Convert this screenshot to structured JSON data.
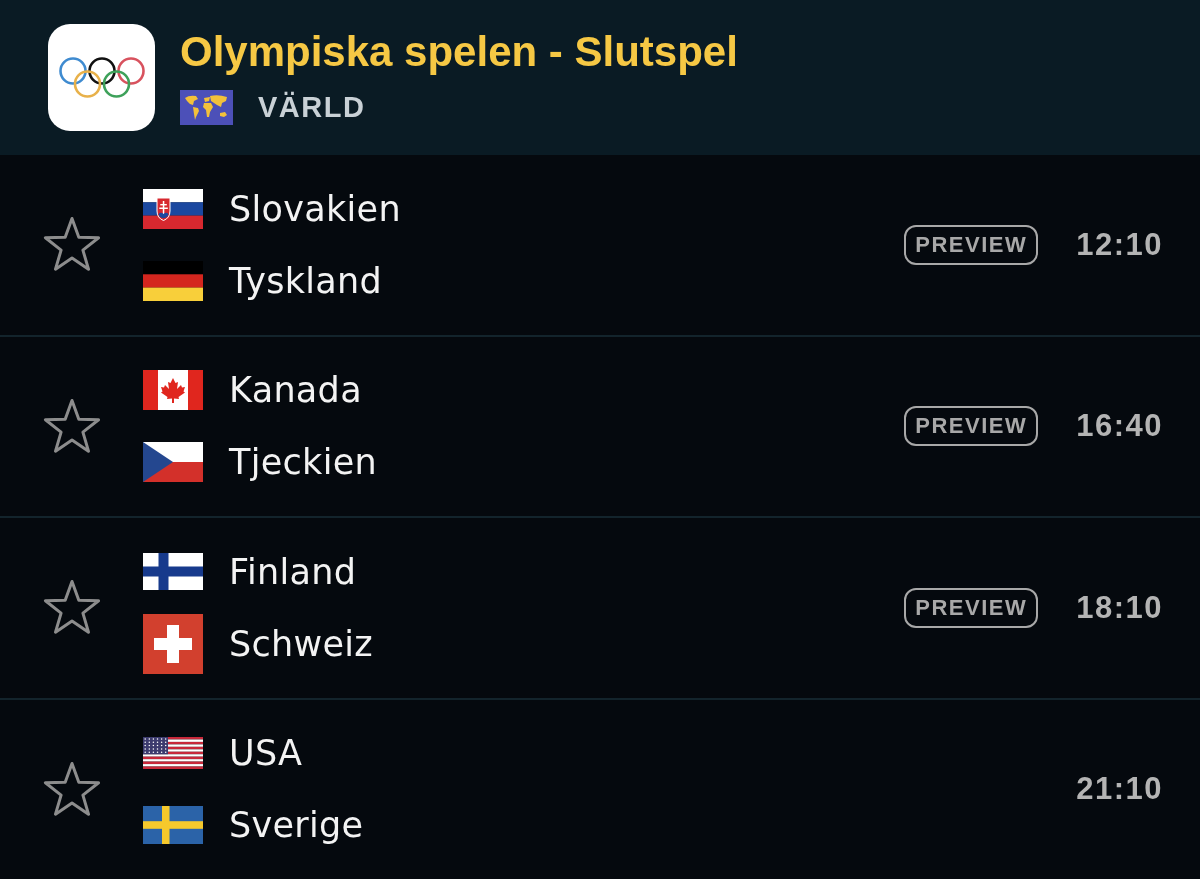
{
  "competition": {
    "title": "Olympiska spelen - Slutspel",
    "region": "VÄRLD"
  },
  "matches": [
    {
      "favorite": false,
      "home": {
        "name": "Slovakien",
        "flag": {
          "kind": "slovakia"
        }
      },
      "away": {
        "name": "Tyskland",
        "flag": {
          "kind": "germany"
        }
      },
      "badge": "PREVIEW",
      "time": "12:10"
    },
    {
      "favorite": false,
      "home": {
        "name": "Kanada",
        "flag": {
          "kind": "canada"
        }
      },
      "away": {
        "name": "Tjeckien",
        "flag": {
          "kind": "czechia"
        }
      },
      "badge": "PREVIEW",
      "time": "16:40"
    },
    {
      "favorite": false,
      "home": {
        "name": "Finland",
        "flag": {
          "kind": "finland"
        }
      },
      "away": {
        "name": "Schweiz",
        "flag": {
          "kind": "switzerland"
        }
      },
      "badge": "PREVIEW",
      "time": "18:10"
    },
    {
      "favorite": false,
      "home": {
        "name": "USA",
        "flag": {
          "kind": "usa"
        }
      },
      "away": {
        "name": "Sverige",
        "flag": {
          "kind": "sweden"
        }
      },
      "time": "21:10"
    }
  ]
}
